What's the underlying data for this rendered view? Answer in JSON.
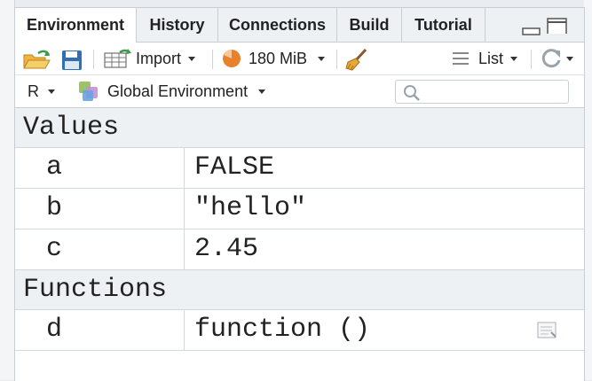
{
  "tabs": [
    {
      "label": "Environment",
      "active": true
    },
    {
      "label": "History",
      "active": false
    },
    {
      "label": "Connections",
      "active": false
    },
    {
      "label": "Build",
      "active": false
    },
    {
      "label": "Tutorial",
      "active": false
    }
  ],
  "toolbar": {
    "import_label": "Import",
    "memory_label": "180 MiB",
    "view_mode_label": "List"
  },
  "env_bar": {
    "language_label": "R",
    "environment_label": "Global Environment",
    "search_placeholder": ""
  },
  "sections": {
    "values_title": "Values",
    "functions_title": "Functions"
  },
  "values": [
    {
      "name": "a",
      "value": "FALSE"
    },
    {
      "name": "b",
      "value": "\"hello\""
    },
    {
      "name": "c",
      "value": "2.45"
    }
  ],
  "functions": [
    {
      "name": "d",
      "value": "function ()"
    }
  ],
  "colors": {
    "accent_orange": "#e8822a",
    "icon_blue": "#2f6fb5",
    "icon_green": "#3a9a4a"
  }
}
